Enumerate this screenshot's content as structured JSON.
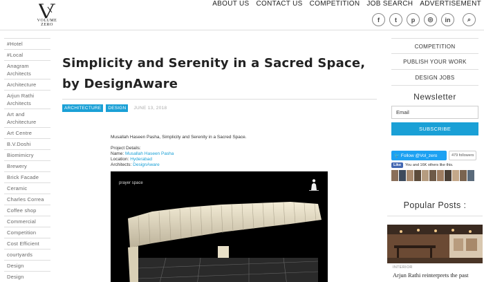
{
  "site": {
    "logo_text": "VOLUME ZERO"
  },
  "topnav": [
    "ABOUT US",
    "CONTACT US",
    "COMPETITION",
    "JOB SEARCH",
    "ADVERTISEMENT"
  ],
  "socials": [
    {
      "icon": "facebook-icon",
      "glyph": "f"
    },
    {
      "icon": "twitter-icon",
      "glyph": "t"
    },
    {
      "icon": "pinterest-icon",
      "glyph": "p"
    },
    {
      "icon": "instagram-icon",
      "glyph": "◎"
    },
    {
      "icon": "linkedin-icon",
      "glyph": "in"
    }
  ],
  "search_glyph": "⌕",
  "sidebar": {
    "items": [
      "#Hotel",
      "#Local",
      "Anagram Architects",
      "Architecture",
      "Arjun Rathi Architects",
      "Art and Architecture",
      "Art Centre",
      "B.V.Doshi",
      "Biomimicry",
      "Brewery",
      "Brick Facade",
      "Ceramic",
      "Charles Correa",
      "Coffee shop",
      "Commercial",
      "Competition",
      "Cost Efficient",
      "courtyards",
      "Design",
      "Design Competition"
    ]
  },
  "article": {
    "title": "Simplicity and Serenity in a Sacred Space, by DesignAware",
    "tags": [
      "ARCHITECTURE",
      "DESIGN"
    ],
    "date": "JUNE 13, 2018",
    "intro": "Musallah Haseen Pasha, Simplicity and Serenity in a Sacred Space.",
    "details_heading": "Project Details:",
    "name_label": "Name: ",
    "name_value": "Musallah Haseen Pasha",
    "location_label": "Location: ",
    "location_value": "Hyderabad",
    "architects_label": "Architects: ",
    "architects_value": "DesignAware",
    "figure_label": "prayer space"
  },
  "right": {
    "links": [
      "COMPETITION",
      "PUBLISH YOUR WORK",
      "DESIGN JOBS"
    ],
    "newsletter_title": "Newsletter",
    "email_placeholder": "Email",
    "subscribe_label": "SUBSCRIBE",
    "twitter_follow": "Follow @Vol_zero",
    "twitter_count": "479 followers",
    "fb_like": "Like",
    "fb_text": "You and 16K others like this.",
    "popular_title": "Popular Posts :",
    "popular_category": "INTERIOR",
    "popular_post_title": "Arjun Rathi reinterprets the past"
  },
  "colors": {
    "accent": "#1aa0d6"
  }
}
